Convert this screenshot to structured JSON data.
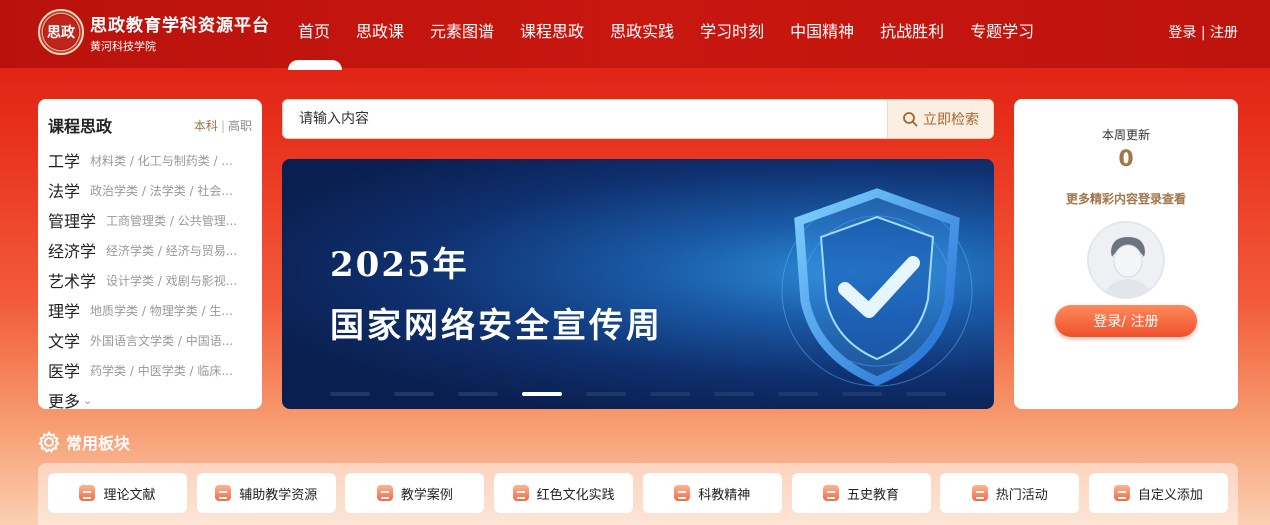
{
  "header": {
    "logo_seal": "思政",
    "title": "思政教育学科资源平台",
    "subtitle": "黄河科技学院",
    "nav": [
      "首页",
      "思政课",
      "元素图谱",
      "课程思政",
      "思政实践",
      "学习时刻",
      "中国精神",
      "抗战胜利",
      "专题学习"
    ],
    "login": "登录",
    "separator": "|",
    "register": "注册"
  },
  "left_panel": {
    "title": "课程思政",
    "tab_undergrad": "本科",
    "tab_sep": "|",
    "tab_vocational": "高职",
    "categories": [
      {
        "name": "工学",
        "desc": "材料类 / 化工与制药类 / ..."
      },
      {
        "name": "法学",
        "desc": "政治学类 / 法学类 / 社会..."
      },
      {
        "name": "管理学",
        "desc": "工商管理类 / 公共管理..."
      },
      {
        "name": "经济学",
        "desc": "经济学类 / 经济与贸易..."
      },
      {
        "name": "艺术学",
        "desc": "设计学类 / 戏剧与影视..."
      },
      {
        "name": "理学",
        "desc": "地质学类 / 物理学类 / 生..."
      },
      {
        "name": "文学",
        "desc": "外国语言文学类 / 中国语..."
      },
      {
        "name": "医学",
        "desc": "药学类 / 中医学类 / 临床..."
      }
    ],
    "more": "更多"
  },
  "search": {
    "placeholder": "请输入内容",
    "button": "立即检索"
  },
  "banner": {
    "year": "2025年",
    "title": "国家网络安全宣传周",
    "slide_count": 10,
    "active_slide": 4
  },
  "right_panel": {
    "week_label": "本周更新",
    "week_count": "0",
    "more_login": "更多精彩内容登录查看",
    "login_button": "登录/ 注册"
  },
  "common": {
    "title": "常用板块",
    "items": [
      "理论文献",
      "辅助教学资源",
      "教学案例",
      "红色文化实践",
      "科教精神",
      "五史教育",
      "热门活动",
      "自定义添加"
    ]
  },
  "colors": {
    "header_red": "#c8170f",
    "accent_gold": "#a0764a",
    "button_orange": "#f0502c"
  }
}
